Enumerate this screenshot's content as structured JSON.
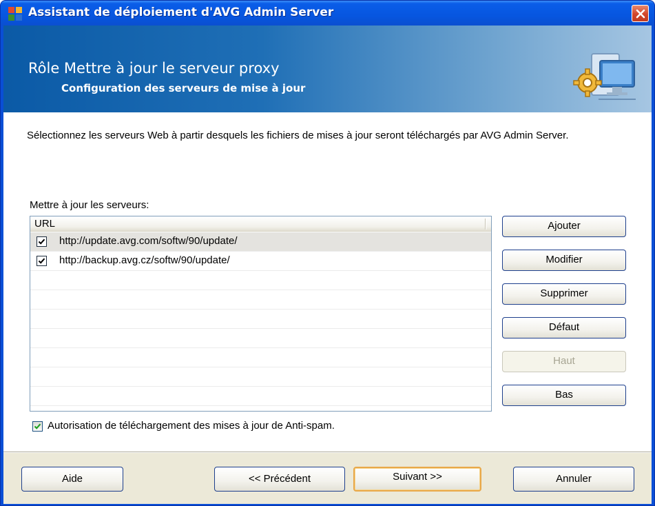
{
  "window": {
    "title": "Assistant de déploiement d'AVG Admin Server"
  },
  "header": {
    "title": "Rôle Mettre à jour le serveur proxy",
    "subtitle": "Configuration des serveurs de mise à jour"
  },
  "intro": "Sélectionnez les serveurs Web à partir desquels les fichiers de mises à jour seront téléchargés par AVG Admin Server.",
  "servers": {
    "label": "Mettre à jour les serveurs:",
    "column_header": "URL",
    "rows": [
      {
        "url": "http://update.avg.com/softw/90/update/",
        "checked": true,
        "selected": true
      },
      {
        "url": "http://backup.avg.cz/softw/90/update/",
        "checked": true,
        "selected": false
      }
    ]
  },
  "side_buttons": {
    "add": "Ajouter",
    "modify": "Modifier",
    "delete": "Supprimer",
    "default": "Défaut",
    "up": "Haut",
    "down": "Bas"
  },
  "antispam": {
    "label": "Autorisation de téléchargement des mises à jour de Anti-spam.",
    "checked": true
  },
  "footer": {
    "help": "Aide",
    "previous": "<< Précédent",
    "next": "Suivant >>",
    "cancel": "Annuler"
  },
  "colors": {
    "titlebar": "#0756e0",
    "header_start": "#0b5aa6",
    "header_end": "#a6c6e2",
    "dialog_bg": "#ece9d8",
    "panel_bg": "#ffffff",
    "focus_border": "#e8a84a",
    "checkbox_check": "#21a121"
  },
  "icons": {
    "title": "avg-logo-icon",
    "close": "close-icon",
    "header": "gear-computer-icon"
  }
}
